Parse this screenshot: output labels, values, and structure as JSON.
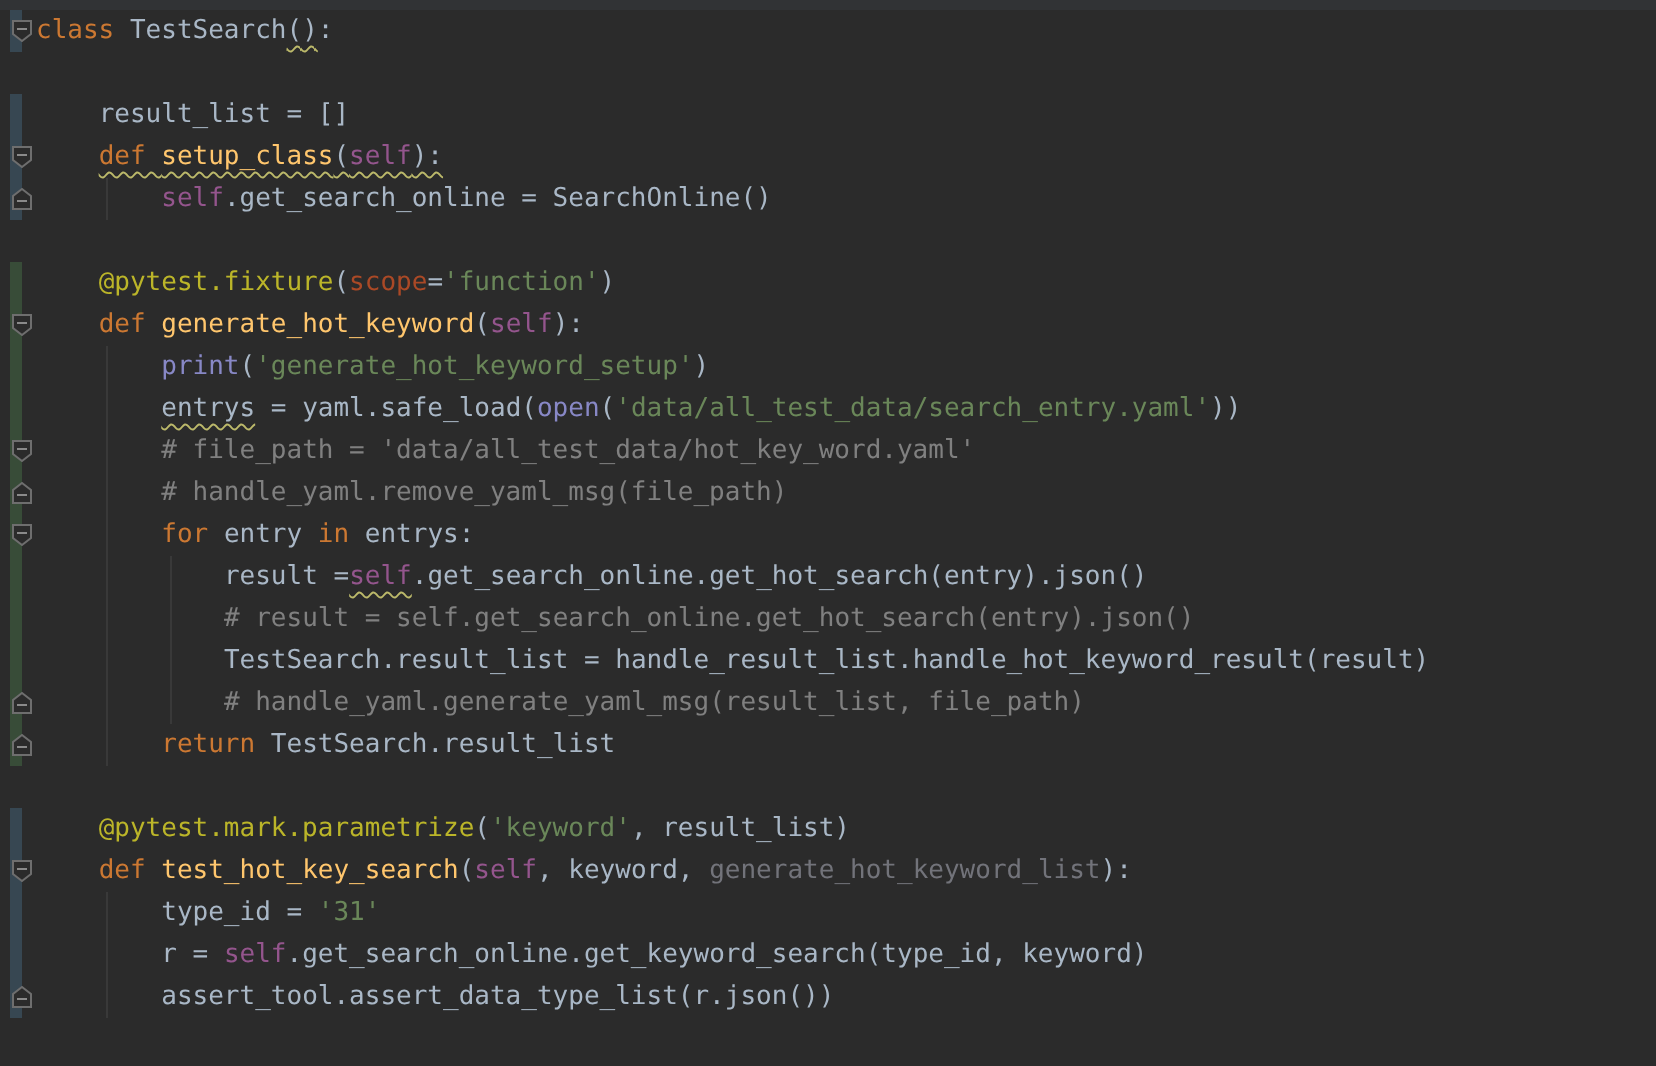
{
  "editor": {
    "lines": [
      {
        "color": "#374752",
        "fold_open": true,
        "fold_close": false,
        "tokens": [
          {
            "text": "class ",
            "kind": "keyword"
          },
          {
            "text": "TestSearch",
            "kind": "plain"
          },
          {
            "text": "()",
            "kind": "plain",
            "warn": true
          },
          {
            "text": ":",
            "kind": "plain"
          }
        ],
        "children": [
          {
            "fold_open": false,
            "fold_close": false
          },
          {
            "color": "#374752",
            "fold_open": false,
            "fold_close": false,
            "tokens": [
              {
                "text": "result_list = []",
                "kind": "plain"
              }
            ]
          },
          {
            "color": "#374752",
            "fold_open": true,
            "fold_close": false,
            "tokens": [
              {
                "text": "def ",
                "kind": "keyword",
                "warn": true
              },
              {
                "text": "setup_class",
                "kind": "function",
                "warn": true
              },
              {
                "text": "(",
                "kind": "plain",
                "warn": true
              },
              {
                "text": "self",
                "kind": "self",
                "warn": true
              },
              {
                "text": "):",
                "kind": "plain",
                "warn": true
              }
            ],
            "children": [
              {
                "color": "#374752",
                "fold_open": false,
                "fold_close": true,
                "tokens": [
                  {
                    "text": "self",
                    "kind": "self"
                  },
                  {
                    "text": ".get_search_online = SearchOnline()",
                    "kind": "plain"
                  }
                ]
              }
            ]
          },
          {
            "fold_open": false,
            "fold_close": false
          },
          {
            "color": "#384c38",
            "fold_open": false,
            "fold_close": false,
            "tokens": [
              {
                "text": "@pytest.fixture",
                "kind": "decorator"
              },
              {
                "text": "(",
                "kind": "plain"
              },
              {
                "text": "scope",
                "kind": "param"
              },
              {
                "text": "=",
                "kind": "plain"
              },
              {
                "text": "'function'",
                "kind": "string"
              },
              {
                "text": ")",
                "kind": "plain"
              }
            ]
          },
          {
            "color": "#384c38",
            "fold_open": true,
            "fold_close": false,
            "tokens": [
              {
                "text": "def ",
                "kind": "keyword"
              },
              {
                "text": "generate_hot_keyword",
                "kind": "function"
              },
              {
                "text": "(",
                "kind": "plain"
              },
              {
                "text": "self",
                "kind": "self"
              },
              {
                "text": "):",
                "kind": "plain"
              }
            ],
            "children": [
              {
                "color": "#384c38",
                "fold_open": false,
                "fold_close": false,
                "tokens": [
                  {
                    "text": "print",
                    "kind": "builtin"
                  },
                  {
                    "text": "(",
                    "kind": "plain"
                  },
                  {
                    "text": "'generate_hot_keyword_setup'",
                    "kind": "string"
                  },
                  {
                    "text": ")",
                    "kind": "plain"
                  }
                ]
              },
              {
                "color": "#384c38",
                "fold_open": false,
                "fold_close": false,
                "tokens": [
                  {
                    "text": "entrys",
                    "kind": "plain",
                    "warn": true
                  },
                  {
                    "text": " = yaml.safe_load(",
                    "kind": "plain"
                  },
                  {
                    "text": "open",
                    "kind": "builtin"
                  },
                  {
                    "text": "(",
                    "kind": "plain"
                  },
                  {
                    "text": "'data/all_test_data/search_entry.yaml'",
                    "kind": "string"
                  },
                  {
                    "text": "))",
                    "kind": "plain"
                  }
                ]
              },
              {
                "color": "#384c38",
                "fold_open": true,
                "fold_close": false,
                "tokens": [
                  {
                    "text": "# file_path = 'data/all_test_data/hot_key_word.yaml'",
                    "kind": "comment"
                  }
                ]
              },
              {
                "color": "#384c38",
                "fold_open": false,
                "fold_close": true,
                "tokens": [
                  {
                    "text": "# handle_yaml.remove_yaml_msg(file_path)",
                    "kind": "comment"
                  }
                ]
              },
              {
                "color": "#384c38",
                "fold_open": true,
                "fold_close": false,
                "tokens": [
                  {
                    "text": "for ",
                    "kind": "keyword"
                  },
                  {
                    "text": "entry ",
                    "kind": "plain"
                  },
                  {
                    "text": "in ",
                    "kind": "keyword"
                  },
                  {
                    "text": "entrys:",
                    "kind": "plain"
                  }
                ],
                "children": [
                  {
                    "color": "#384c38",
                    "fold_open": false,
                    "fold_close": false,
                    "tokens": [
                      {
                        "text": "result =",
                        "kind": "plain"
                      },
                      {
                        "text": "self",
                        "kind": "self",
                        "warn": true
                      },
                      {
                        "text": ".get_search_online.get_hot_search(entry).json()",
                        "kind": "plain"
                      }
                    ]
                  },
                  {
                    "color": "#384c38",
                    "fold_open": false,
                    "fold_close": false,
                    "tokens": [
                      {
                        "text": "# result = self.get_search_online.get_hot_search(entry).json()",
                        "kind": "comment"
                      }
                    ]
                  },
                  {
                    "color": "#384c38",
                    "fold_open": false,
                    "fold_close": false,
                    "tokens": [
                      {
                        "text": "TestSearch.result_list = handle_result_list.handle_hot_keyword_result(result)",
                        "kind": "plain"
                      }
                    ]
                  },
                  {
                    "color": "#384c38",
                    "fold_open": false,
                    "fold_close": true,
                    "tokens": [
                      {
                        "text": "# handle_yaml.generate_yaml_msg(result_list, file_path)",
                        "kind": "comment"
                      }
                    ]
                  }
                ]
              },
              {
                "color": "#384c38",
                "fold_open": false,
                "fold_close": true,
                "tokens": [
                  {
                    "text": "return ",
                    "kind": "keyword"
                  },
                  {
                    "text": "TestSearch.result_list",
                    "kind": "plain"
                  }
                ]
              }
            ]
          },
          {
            "fold_open": false,
            "fold_close": false
          },
          {
            "color": "#374752",
            "fold_open": false,
            "fold_close": false,
            "tokens": [
              {
                "text": "@pytest.mark.parametrize",
                "kind": "decorator"
              },
              {
                "text": "(",
                "kind": "plain"
              },
              {
                "text": "'keyword'",
                "kind": "string"
              },
              {
                "text": ", result_list)",
                "kind": "plain"
              }
            ]
          },
          {
            "color": "#374752",
            "fold_open": true,
            "fold_close": false,
            "tokens": [
              {
                "text": "def ",
                "kind": "keyword"
              },
              {
                "text": "test_hot_key_search",
                "kind": "function"
              },
              {
                "text": "(",
                "kind": "plain"
              },
              {
                "text": "self",
                "kind": "self"
              },
              {
                "text": ", keyword, ",
                "kind": "plain"
              },
              {
                "text": "generate_hot_keyword_list",
                "kind": "unused"
              },
              {
                "text": "):",
                "kind": "plain"
              }
            ],
            "children": [
              {
                "color": "#374752",
                "fold_open": false,
                "fold_close": false,
                "tokens": [
                  {
                    "text": "type_id = ",
                    "kind": "plain"
                  },
                  {
                    "text": "'31'",
                    "kind": "string"
                  }
                ]
              },
              {
                "color": "#374752",
                "fold_open": false,
                "fold_close": false,
                "tokens": [
                  {
                    "text": "r = ",
                    "kind": "plain"
                  },
                  {
                    "text": "self",
                    "kind": "self"
                  },
                  {
                    "text": ".get_search_online.get_keyword_search(type_id, keyword)",
                    "kind": "plain"
                  }
                ]
              },
              {
                "color": "#374752",
                "fold_open": false,
                "fold_close": true,
                "tokens": [
                  {
                    "text": "assert_tool.assert_data_type_list(r.json())",
                    "kind": "plain"
                  }
                ]
              }
            ]
          }
        ]
      }
    ]
  }
}
